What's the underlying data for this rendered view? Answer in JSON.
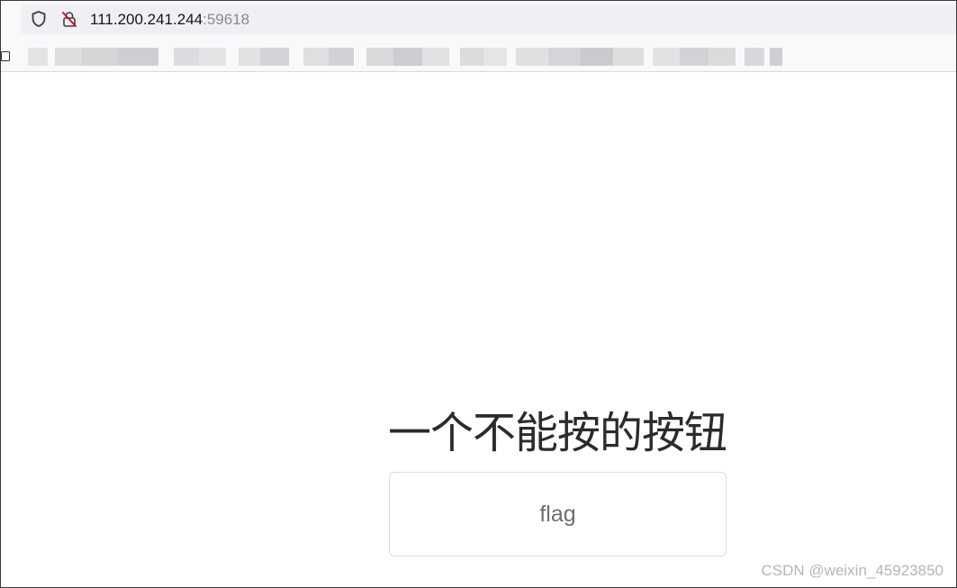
{
  "browser": {
    "url_host": "111.200.241.244",
    "url_port": ":59618",
    "icons": {
      "tracking_protection": "shield-icon",
      "connection": "insecure-lock-icon",
      "bookmark_folder": "folder-icon"
    },
    "colors": {
      "chrome_bg": "#f9f9fb",
      "urlbar_bg": "#f0f0f4",
      "insecure_lock": "#d70022"
    }
  },
  "page": {
    "heading": "一个不能按的按钮",
    "button_label": "flag"
  },
  "watermark": {
    "text": "CSDN @weixin_45923850"
  }
}
